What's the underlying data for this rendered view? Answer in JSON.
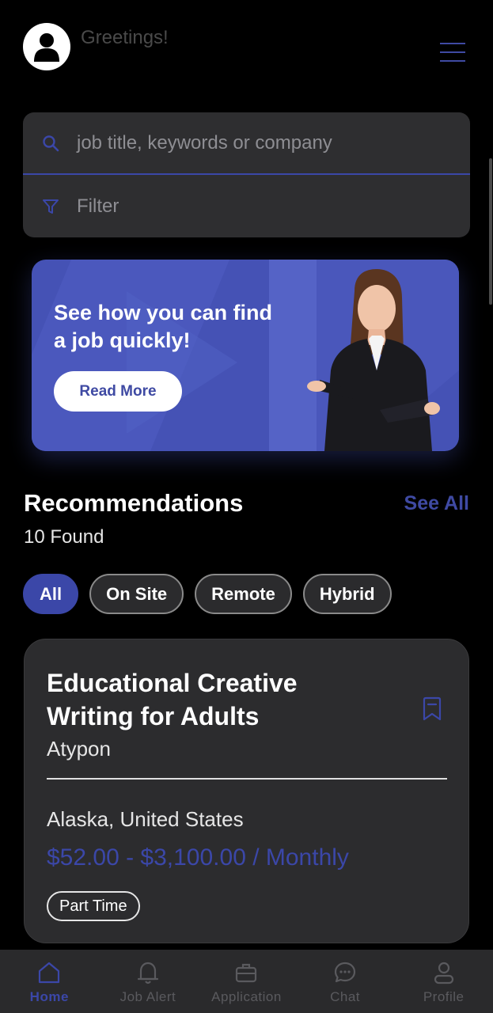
{
  "header": {
    "greeting": "Greetings!"
  },
  "search": {
    "placeholder": "job title, keywords or company",
    "filter_label": "Filter"
  },
  "banner": {
    "title": "See how you can find a job quickly!",
    "button_label": "Read More"
  },
  "recommendations": {
    "title": "Recommendations",
    "count_text": "10 Found",
    "see_all_label": "See All",
    "chips": [
      {
        "label": "All",
        "active": true
      },
      {
        "label": "On Site",
        "active": false
      },
      {
        "label": "Remote",
        "active": false
      },
      {
        "label": "Hybrid",
        "active": false
      }
    ]
  },
  "job": {
    "title": "Educational Creative Writing for Adults",
    "company": "Atypon",
    "location": "Alaska,  United States",
    "salary": "$52.00 - $3,100.00 / Monthly",
    "type_tag": "Part Time"
  },
  "bottom_nav": [
    {
      "label": "Home",
      "icon": "home-icon",
      "active": true
    },
    {
      "label": "Job Alert",
      "icon": "bell-icon",
      "active": false
    },
    {
      "label": "Application",
      "icon": "briefcase-icon",
      "active": false
    },
    {
      "label": "Chat",
      "icon": "chat-icon",
      "active": false
    },
    {
      "label": "Profile",
      "icon": "user-icon",
      "active": false
    }
  ],
  "colors": {
    "accent": "#3b47a8",
    "banner": "#4552b5",
    "card": "#2c2c2e",
    "background": "#000000"
  }
}
